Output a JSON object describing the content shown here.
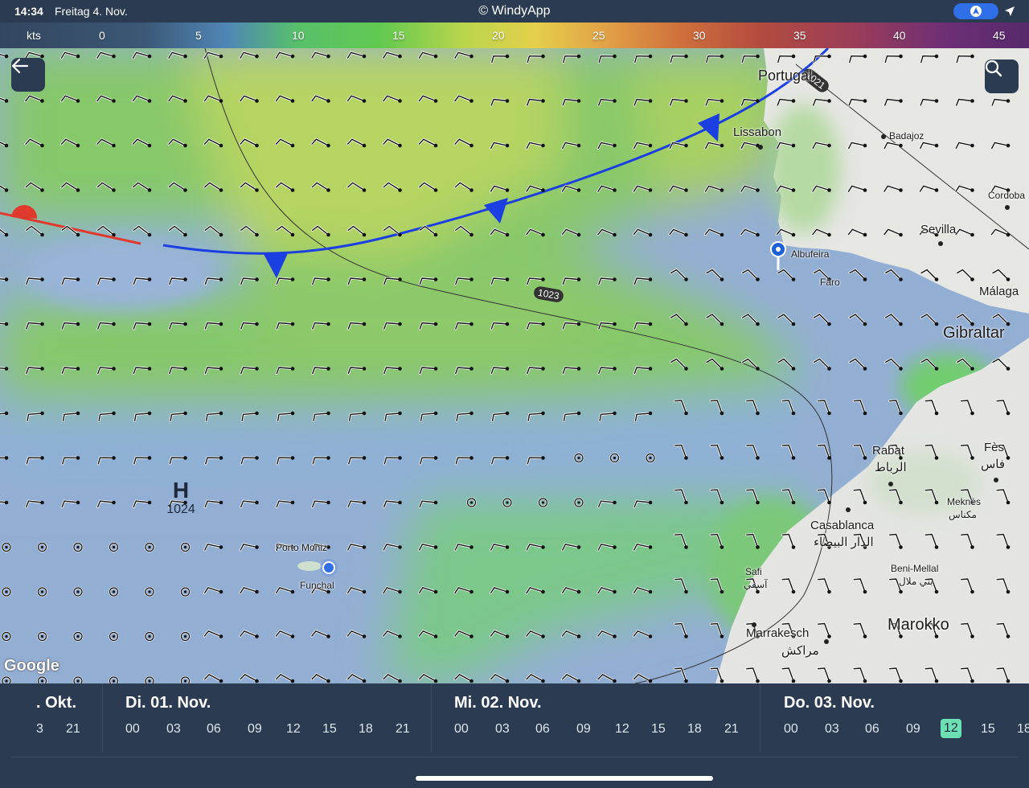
{
  "status_bar": {
    "time": "14:34",
    "date": "Freitag 4. Nov.",
    "app_title": "© WindyApp"
  },
  "legend": {
    "unit": "kts",
    "ticks": [
      "0",
      "5",
      "10",
      "15",
      "20",
      "25",
      "30",
      "35",
      "40",
      "45"
    ]
  },
  "map": {
    "pressure_high": {
      "symbol": "H",
      "value": "1024"
    },
    "isobar_labels": [
      "1023",
      "1021"
    ],
    "attribution": "Google",
    "places": {
      "portugal": "Portugal",
      "lisbon": "Lissabon",
      "badajoz": "Badajoz",
      "cordoba": "Cordoba",
      "sevilla": "Sevilla",
      "albufeira": "Albufeira",
      "faro": "Faro",
      "malaga": "Málaga",
      "gibraltar": "Gibraltar",
      "rabat": "Rabat",
      "rabat_ar": "الرباط",
      "fes": "Fès",
      "fes_ar": "فاس",
      "meknes": "Meknès",
      "meknes_ar": "مكناس",
      "casablanca": "Casablanca",
      "casablanca_ar": "الدار البيضاء",
      "safi": "Safi",
      "safi_ar": "آسفي",
      "beni_mellal": "Beni-Mellal",
      "beni_mellal_ar": "بني ملال",
      "marrakesch": "Marrakesch",
      "marrakesch_ar": "مراكش",
      "marokko": "Marokko",
      "porto_moniz": "Porto Moniz",
      "funchal": "Funchal"
    }
  },
  "timeline": {
    "days": [
      {
        "label": ". Okt.",
        "hours": [
          "3",
          "21"
        ]
      },
      {
        "label": "Di. 01. Nov.",
        "hours": [
          "00",
          "03",
          "06",
          "09",
          "12",
          "15",
          "18",
          "21"
        ]
      },
      {
        "label": "Mi. 02. Nov.",
        "hours": [
          "00",
          "03",
          "06",
          "09",
          "12",
          "15",
          "18",
          "21"
        ]
      },
      {
        "label": "Do. 03. Nov.",
        "hours": [
          "00",
          "03",
          "06",
          "09",
          "12",
          "15",
          "18"
        ]
      }
    ],
    "selected": {
      "day": "Do. 03. Nov.",
      "hour": "12"
    }
  }
}
